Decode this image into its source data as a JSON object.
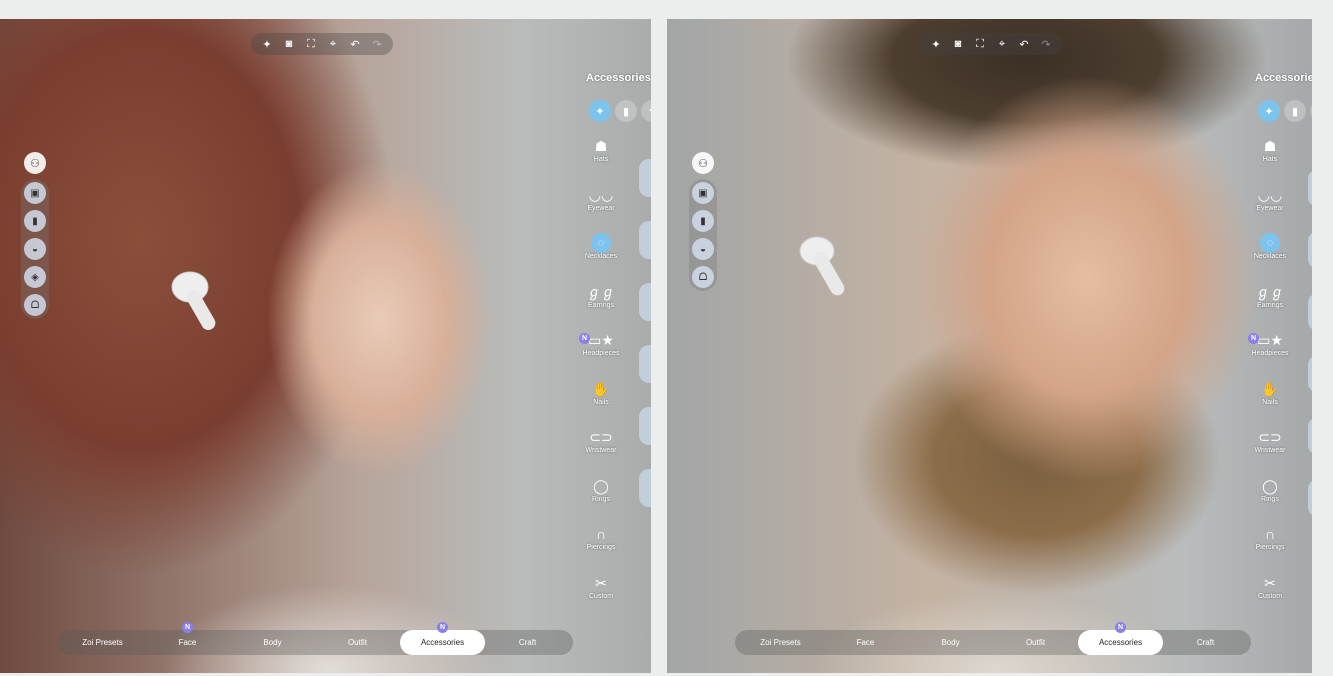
{
  "toolbar": {
    "buttons": [
      {
        "name": "magic-wand-icon",
        "glyph": "✦"
      },
      {
        "name": "camera-icon",
        "glyph": "◙"
      },
      {
        "name": "frame-icon",
        "glyph": "⛶"
      },
      {
        "name": "focus-icon",
        "glyph": "⌖"
      },
      {
        "name": "undo-icon",
        "glyph": "↶"
      },
      {
        "name": "redo-icon",
        "glyph": "↷"
      }
    ]
  },
  "rail": {
    "top_icon": "⚇",
    "left_items": [
      "▣",
      "▮",
      "◒",
      "◈",
      "ᗝ"
    ],
    "right_items": [
      "▣",
      "▮",
      "◒",
      "ᗝ"
    ]
  },
  "accessories": {
    "title": "Accessories",
    "tab_glyphs": [
      "✦",
      "▮",
      "◓"
    ],
    "categories": [
      {
        "id": "hats",
        "label": "Hats",
        "glyph": "☗"
      },
      {
        "id": "eyewear",
        "label": "Eyewear",
        "glyph": "◡◡"
      },
      {
        "id": "necklaces",
        "label": "Necklaces",
        "glyph": "◌",
        "active": true
      },
      {
        "id": "earrings",
        "label": "Earrings",
        "glyph": "ℊℊ"
      },
      {
        "id": "headpieces",
        "label": "Headpieces",
        "glyph": "▭★",
        "badge": "N"
      },
      {
        "id": "nails",
        "label": "Nails",
        "glyph": "✋"
      },
      {
        "id": "wristwear",
        "label": "Wristwear",
        "glyph": "⊂⊃"
      },
      {
        "id": "rings",
        "label": "Rings",
        "glyph": "◯"
      },
      {
        "id": "piercings",
        "label": "Piercings",
        "glyph": "∩"
      },
      {
        "id": "custom",
        "label": "Custom",
        "glyph": "✂"
      }
    ]
  },
  "bottom_nav": {
    "tabs": [
      {
        "label": "Zoi Presets"
      },
      {
        "label": "Face"
      },
      {
        "label": "Body"
      },
      {
        "label": "Outfit"
      },
      {
        "label": "Accessories",
        "active": true
      },
      {
        "label": "Craft"
      }
    ],
    "left_badges": [
      {
        "tab": 1,
        "text": "N"
      },
      {
        "tab": 4,
        "text": "N"
      }
    ],
    "right_badges": [
      {
        "tab": 4,
        "text": "N"
      }
    ]
  },
  "colors": {
    "accent": "#7cc4ee",
    "badge": "#8b7fe8"
  }
}
